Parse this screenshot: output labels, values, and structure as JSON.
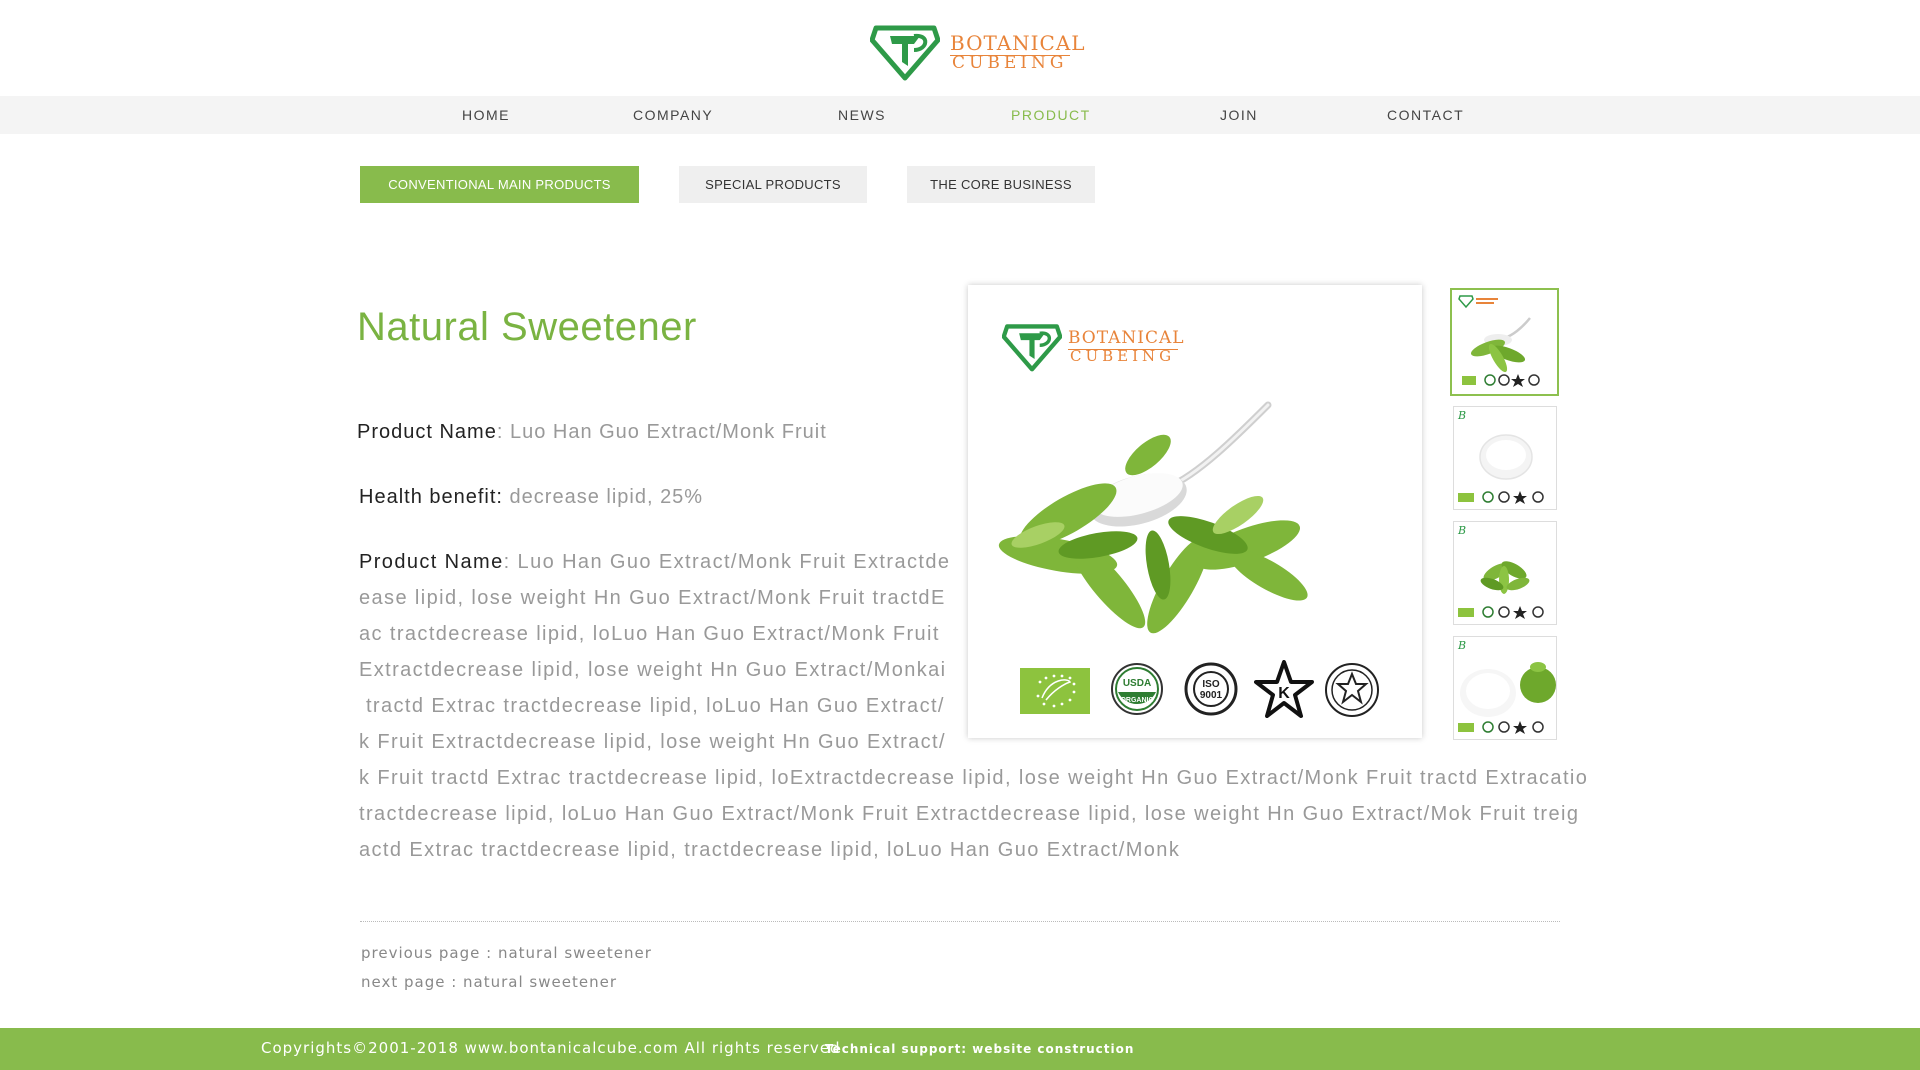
{
  "brand": {
    "line1": "BOTANICAL",
    "line2": "CUBEING"
  },
  "nav": {
    "items": [
      {
        "label": "HOME"
      },
      {
        "label": "COMPANY"
      },
      {
        "label": "NEWS"
      },
      {
        "label": "PRODUCT",
        "active": true
      },
      {
        "label": "JOIN"
      },
      {
        "label": "CONTACT"
      }
    ]
  },
  "tabs": [
    {
      "label": "CONVENTIONAL MAIN PRODUCTS",
      "active": true
    },
    {
      "label": "SPECIAL PRODUCTS"
    },
    {
      "label": "THE CORE BUSINESS"
    }
  ],
  "product": {
    "title": "Natural Sweetener",
    "name_label": "Product Name",
    "name_value": ": Luo Han Guo Extract/Monk Fruit",
    "benefit_label": "Health benefit:",
    "benefit_value": " decrease lipid, 25%",
    "desc_label": "Product Name",
    "desc_lines": [
      ": Luo Han Guo Extract/Monk Fruit Extractde",
      "ease lipid, lose weight Hn Guo Extract/Monk Fruit tractdE",
      "ac tractdecrease lipid, loLuo Han Guo Extract/Monk Fruit",
      "Extractdecrease lipid, lose weight Hn Guo Extract/Monkai",
      " tractd Extrac tractdecrease lipid, loLuo Han Guo Extract/",
      "k Fruit Extractdecrease lipid, lose weight Hn Guo Extract/",
      "k Fruit tractd Extrac tractdecrease lipid, loExtractdecrease lipid, lose weight Hn Guo Extract/Monk Fruit tractd Extracatio",
      "tractdecrease lipid, loLuo Han Guo Extract/Monk Fruit Extractdecrease lipid, lose weight Hn Guo Extract/Mok Fruit treig",
      "actd Extrac tractdecrease lipid, tractdecrease lipid, loLuo Han Guo Extract/Monk"
    ]
  },
  "main_image": {
    "logo_line1": "BOTANICAL",
    "logo_line2": "CUBEING",
    "certs": [
      "eu-organic-leaf-icon",
      "usda-organic-seal",
      "iso-9001-seal",
      "kosher-star-icon",
      "halal-seal"
    ],
    "usda_text": "USDA",
    "organic_text": "ORGANIC",
    "iso_text": "ISO",
    "iso_num": "9001"
  },
  "thumbnails": [
    {
      "name": "thumb-stevia-spoon",
      "active": true
    },
    {
      "name": "thumb-white-powder"
    },
    {
      "name": "thumb-stevia-leaves"
    },
    {
      "name": "thumb-powder-with-leaf"
    }
  ],
  "pagination": {
    "previous": "previous page : natural sweetener",
    "next": "next page : natural sweetener"
  },
  "footer": {
    "copyright": "Copyrights©2001-2018 www.bontanicalcube.com All rights reserved",
    "tech": "Technical support: website construction"
  },
  "colors": {
    "accent": "#88bb4c",
    "brand_orange": "#e8843a",
    "brand_green": "#2e9a48"
  }
}
